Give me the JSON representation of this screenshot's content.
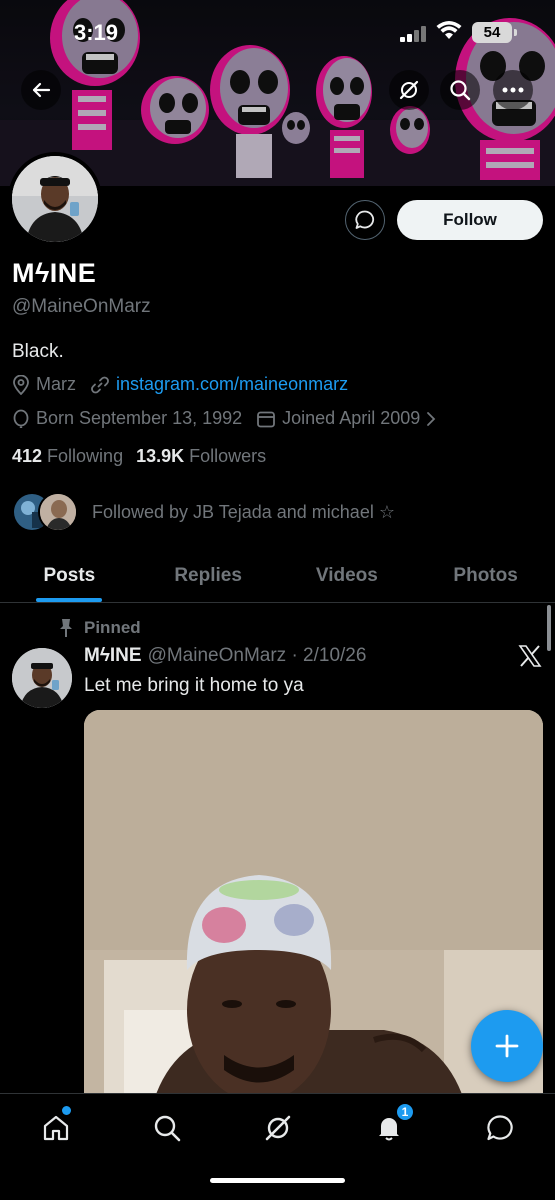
{
  "status_bar": {
    "time": "3:19",
    "battery": "54"
  },
  "profile": {
    "name": "MϟINE",
    "handle": "@MaineOnMarz",
    "bio": "Black.",
    "location": "Marz",
    "website": "instagram.com/maineonmarz",
    "born": "Born September 13, 1992",
    "joined": "Joined April 2009",
    "following_count": "412",
    "following_label": "Following",
    "followers_count": "13.9K",
    "followers_label": "Followers",
    "followed_by": "Followed by JB Tejada and michael ☆",
    "follow_label": "Follow"
  },
  "tabs": [
    {
      "label": "Posts",
      "active": true
    },
    {
      "label": "Replies",
      "active": false
    },
    {
      "label": "Videos",
      "active": false
    },
    {
      "label": "Photos",
      "active": false
    }
  ],
  "post": {
    "pinned_label": "Pinned",
    "author": "MϟINE",
    "handle_date": "@MaineOnMarz · 2/10/26",
    "text": "Let me bring it home to ya"
  },
  "bottom_nav": {
    "notifications_badge": "1"
  },
  "colors": {
    "accent": "#1d9bf0",
    "background": "#000000",
    "muted": "#71767b",
    "text": "#e7e9ea",
    "banner_pink": "#e0108a"
  },
  "icons": [
    "back-arrow-icon",
    "grok-icon",
    "search-icon",
    "more-icon",
    "message-icon",
    "location-icon",
    "link-icon",
    "birthday-icon",
    "calendar-icon",
    "chevron-right-icon",
    "pin-icon",
    "x-logo-icon",
    "plus-icon",
    "home-icon",
    "explore-icon",
    "grok-nav-icon",
    "bell-icon",
    "messages-icon"
  ]
}
